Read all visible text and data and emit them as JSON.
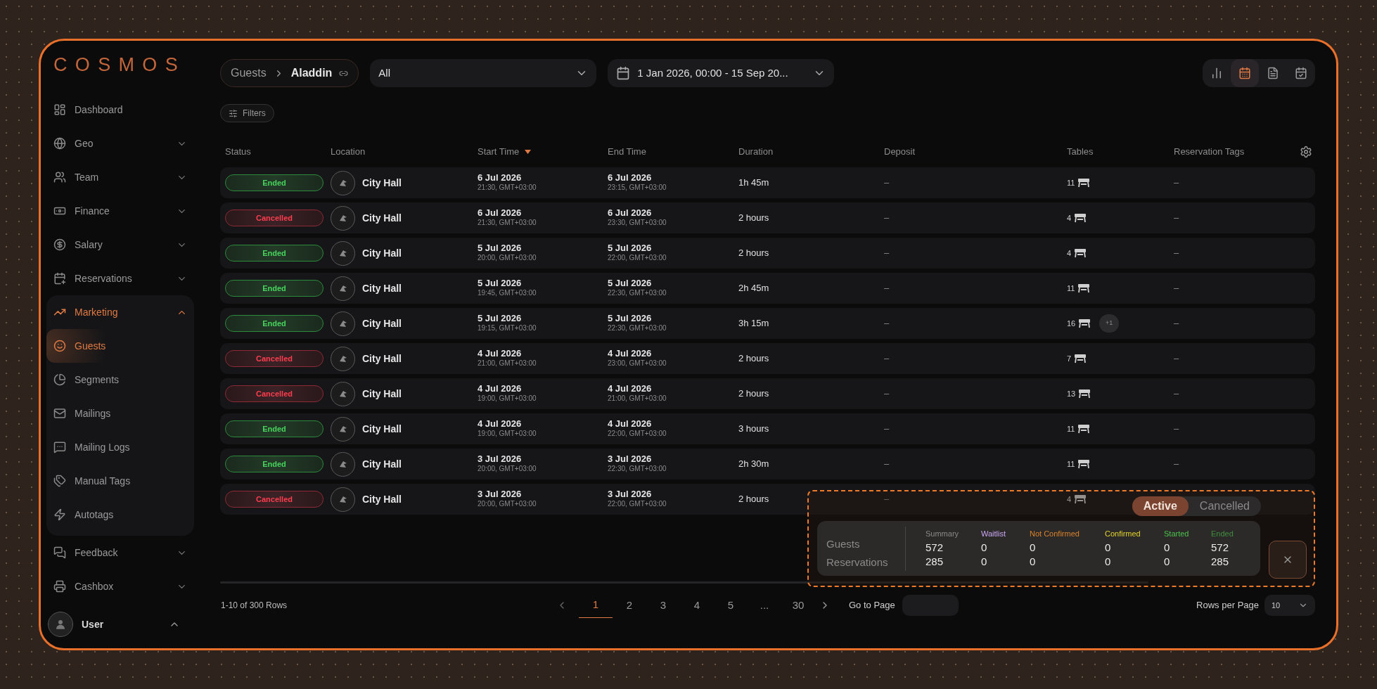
{
  "sidebar": {
    "logo": "COSMOS",
    "items": [
      {
        "label": "Dashboard",
        "selected": false
      },
      {
        "label": "Geo",
        "selected": false,
        "expanded": false
      },
      {
        "label": "Team",
        "selected": false,
        "expanded": false
      },
      {
        "label": "Finance",
        "selected": false,
        "expanded": false
      },
      {
        "label": "Salary",
        "selected": false,
        "expanded": false
      },
      {
        "label": "Reservations",
        "selected": false,
        "expanded": false
      },
      {
        "label": "Marketing",
        "selected": true,
        "expanded": true,
        "children": [
          {
            "label": "Guests",
            "selected": true
          },
          {
            "label": "Segments",
            "selected": false
          },
          {
            "label": "Mailings",
            "selected": false
          },
          {
            "label": "Mailing Logs",
            "selected": false
          },
          {
            "label": "Manual Tags",
            "selected": false
          },
          {
            "label": "Autotags",
            "selected": false
          }
        ]
      },
      {
        "label": "Feedback",
        "selected": false,
        "expanded": false
      },
      {
        "label": "Cashbox",
        "selected": false,
        "expanded": false
      }
    ],
    "user": {
      "name": "User",
      "expanded": true
    }
  },
  "toolbar": {
    "breadcrumb": [
      "Guests",
      "Aladdin"
    ],
    "select": "All",
    "date_range": "1 Jan 2026, 00:00 - 15 Sep 20...",
    "views": [
      {
        "selected": false
      },
      {
        "selected": true
      },
      {
        "selected": false
      },
      {
        "selected": false
      }
    ],
    "filters": "Filters"
  },
  "table": {
    "columns": [
      {
        "label": "Status",
        "sorted": false
      },
      {
        "label": "Location",
        "sorted": false
      },
      {
        "label": "Start Time",
        "sorted": true
      },
      {
        "label": "End Time",
        "sorted": false
      },
      {
        "label": "Duration",
        "sorted": false
      },
      {
        "label": "Deposit",
        "sorted": false
      },
      {
        "label": "Tables",
        "sorted": false
      },
      {
        "label": "Reservation Tags",
        "sorted": false
      }
    ],
    "rows": [
      {
        "status": {
          "text": "Ended",
          "kind": "ended"
        },
        "location": "City Hall",
        "start": {
          "date": "6 Jul 2026",
          "time": "21:30, GMT+03:00"
        },
        "end": {
          "date": "6 Jul 2026",
          "time": "23:15, GMT+03:00"
        },
        "duration": "1h 45m",
        "deposit": "–",
        "tables": "11",
        "tags": "–"
      },
      {
        "status": {
          "text": "Cancelled",
          "kind": "cancelled"
        },
        "location": "City Hall",
        "start": {
          "date": "6 Jul 2026",
          "time": "21:30, GMT+03:00"
        },
        "end": {
          "date": "6 Jul 2026",
          "time": "23:30, GMT+03:00"
        },
        "duration": "2 hours",
        "deposit": "–",
        "tables": "4",
        "tags": "–"
      },
      {
        "status": {
          "text": "Ended",
          "kind": "ended"
        },
        "location": "City Hall",
        "start": {
          "date": "5 Jul 2026",
          "time": "20:00, GMT+03:00"
        },
        "end": {
          "date": "5 Jul 2026",
          "time": "22:00, GMT+03:00"
        },
        "duration": "2 hours",
        "deposit": "–",
        "tables": "4",
        "tags": "–"
      },
      {
        "status": {
          "text": "Ended",
          "kind": "ended"
        },
        "location": "City Hall",
        "start": {
          "date": "5 Jul 2026",
          "time": "19:45, GMT+03:00"
        },
        "end": {
          "date": "5 Jul 2026",
          "time": "22:30, GMT+03:00"
        },
        "duration": "2h 45m",
        "deposit": "–",
        "tables": "11",
        "tags": "–"
      },
      {
        "status": {
          "text": "Ended",
          "kind": "ended"
        },
        "location": "City Hall",
        "start": {
          "date": "5 Jul 2026",
          "time": "19:15, GMT+03:00"
        },
        "end": {
          "date": "5 Jul 2026",
          "time": "22:30, GMT+03:00"
        },
        "duration": "3h 15m",
        "deposit": "–",
        "tables": "16",
        "tables_more": "+1",
        "tags": "–"
      },
      {
        "status": {
          "text": "Cancelled",
          "kind": "cancelled"
        },
        "location": "City Hall",
        "start": {
          "date": "4 Jul 2026",
          "time": "21:00, GMT+03:00"
        },
        "end": {
          "date": "4 Jul 2026",
          "time": "23:00, GMT+03:00"
        },
        "duration": "2 hours",
        "deposit": "–",
        "tables": "7",
        "tags": "–"
      },
      {
        "status": {
          "text": "Cancelled",
          "kind": "cancelled"
        },
        "location": "City Hall",
        "start": {
          "date": "4 Jul 2026",
          "time": "19:00, GMT+03:00"
        },
        "end": {
          "date": "4 Jul 2026",
          "time": "21:00, GMT+03:00"
        },
        "duration": "2 hours",
        "deposit": "–",
        "tables": "13",
        "tags": "–"
      },
      {
        "status": {
          "text": "Ended",
          "kind": "ended"
        },
        "location": "City Hall",
        "start": {
          "date": "4 Jul 2026",
          "time": "19:00, GMT+03:00"
        },
        "end": {
          "date": "4 Jul 2026",
          "time": "22:00, GMT+03:00"
        },
        "duration": "3 hours",
        "deposit": "–",
        "tables": "11",
        "tags": "–"
      },
      {
        "status": {
          "text": "Ended",
          "kind": "ended"
        },
        "location": "City Hall",
        "start": {
          "date": "3 Jul 2026",
          "time": "20:00, GMT+03:00"
        },
        "end": {
          "date": "3 Jul 2026",
          "time": "22:30, GMT+03:00"
        },
        "duration": "2h 30m",
        "deposit": "–",
        "tables": "11",
        "tags": "–"
      },
      {
        "status": {
          "text": "Cancelled",
          "kind": "cancelled"
        },
        "location": "City Hall",
        "start": {
          "date": "3 Jul 2026",
          "time": "20:00, GMT+03:00"
        },
        "end": {
          "date": "3 Jul 2026",
          "time": "22:00, GMT+03:00"
        },
        "duration": "2 hours",
        "deposit": "–",
        "tables": "4"
      }
    ]
  },
  "summary": {
    "tabs": [
      {
        "label": "Active",
        "selected": true
      },
      {
        "label": "Cancelled",
        "selected": false
      }
    ],
    "row_labels": [
      "Guests",
      "Reservations"
    ],
    "columns": [
      {
        "label": "Summary",
        "color": "#8a8a8a",
        "values": [
          "572",
          "285"
        ]
      },
      {
        "label": "Waitlist",
        "color": "#c9a8f2",
        "values": [
          "0",
          "0"
        ]
      },
      {
        "label": "Not Confirmed",
        "color": "#d9822b",
        "values": [
          "0",
          "0"
        ]
      },
      {
        "label": "Confirmed",
        "color": "#e3d52f",
        "values": [
          "0",
          "0"
        ]
      },
      {
        "label": "Started",
        "color": "#4cc34c",
        "values": [
          "0",
          "0"
        ]
      },
      {
        "label": "Ended",
        "color": "#3f8f3f",
        "values": [
          "572",
          "285"
        ]
      }
    ]
  },
  "pagination": {
    "range": "1-10 of 300 Rows",
    "pages": [
      {
        "label": "1",
        "selected": true
      },
      {
        "label": "2",
        "selected": false
      },
      {
        "label": "3",
        "selected": false
      },
      {
        "label": "4",
        "selected": false
      },
      {
        "label": "5",
        "selected": false
      },
      {
        "label": "...",
        "selected": false
      },
      {
        "label": "30",
        "selected": false
      }
    ],
    "go_to_page": "Go to Page",
    "rows_per_page": "Rows per Page",
    "rows_value": "10"
  }
}
